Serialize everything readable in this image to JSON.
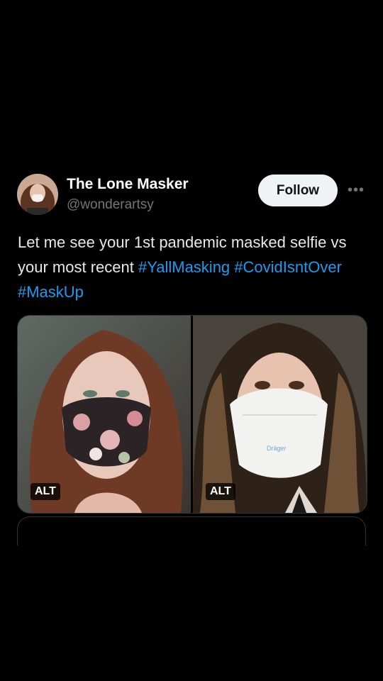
{
  "author": {
    "display_name": "The Lone Masker",
    "handle": "@wonderartsy"
  },
  "follow_label": "Follow",
  "more_icon": "more-horizontal-icon",
  "text": {
    "body": "Let me see your 1st pandemic masked selfie vs your most recent ",
    "hashtags": [
      "#YallMasking",
      "#CovidIsntOver",
      "#MaskUp"
    ]
  },
  "media": {
    "images": [
      {
        "alt_badge": "ALT",
        "description_icon": "floral-mask-selfie"
      },
      {
        "alt_badge": "ALT",
        "description_icon": "white-respirator-selfie"
      }
    ],
    "respirator_brand": "Dräger"
  },
  "colors": {
    "background": "#000000",
    "text": "#e7e9ea",
    "muted": "#71767b",
    "link": "#1d9bf0",
    "button_bg": "#eff3f4"
  }
}
